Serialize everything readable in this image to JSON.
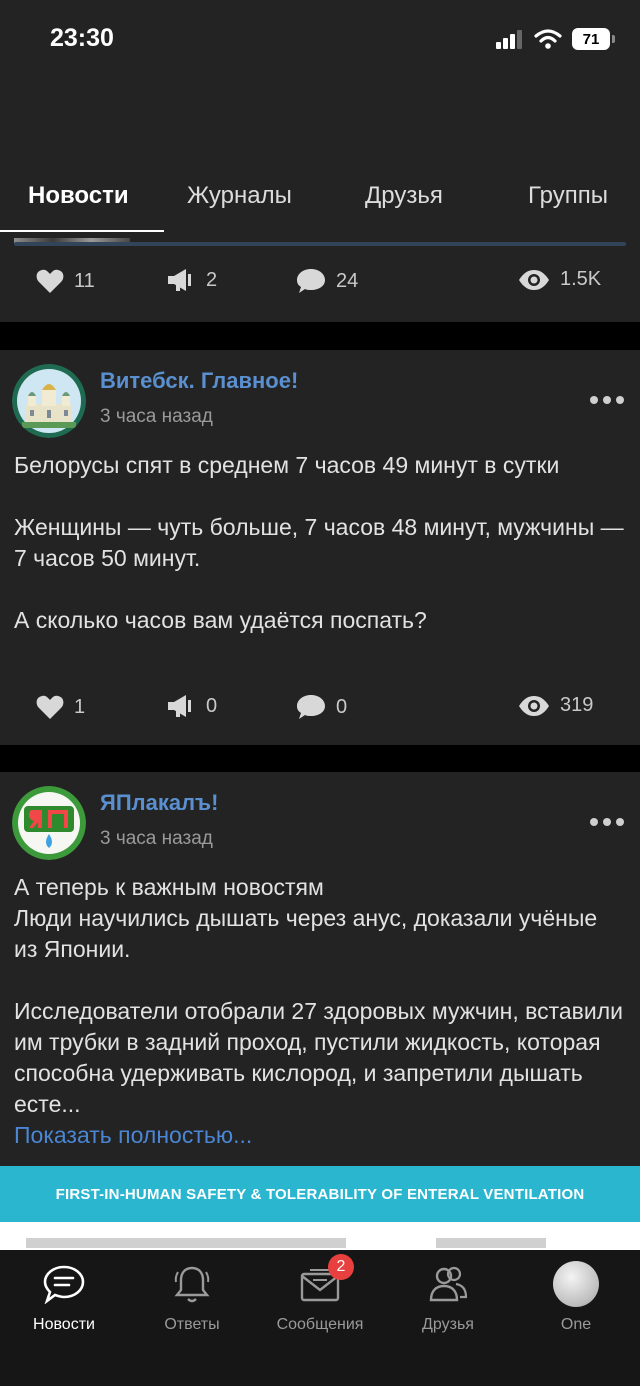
{
  "status_bar": {
    "time": "23:30",
    "battery": "71"
  },
  "tabs": [
    {
      "label": "Новости",
      "active": true
    },
    {
      "label": "Журналы",
      "active": false
    },
    {
      "label": "Друзья",
      "active": false
    },
    {
      "label": "Группы",
      "active": false
    }
  ],
  "post1": {
    "likes": "11",
    "reposts": "2",
    "comments": "24",
    "views": "1.5K"
  },
  "post2": {
    "group": "Витебск. Главное!",
    "time": "3 часа назад",
    "lines": [
      "Белорусы спят в среднем 7 часов 49 минут в сутки",
      "",
      "Женщины — чуть больше, 7 часов 48 минут, мужчины — 7 часов 50 минут.",
      "",
      "А сколько часов вам удаётся поспать?"
    ],
    "likes": "1",
    "reposts": "0",
    "comments": "0",
    "views": "319"
  },
  "post3": {
    "group": "ЯПлакалъ!",
    "time": "3 часа назад",
    "lines": [
      "А теперь к важным новостям",
      "Люди научились дышать через анус, доказали учёные из Японии.",
      "",
      "Исследователи отобрали 27 здоровых мужчин, вставили им трубки в задний проход, пустили жидкость, которая способна удерживать кислород, и запретили дышать есте..."
    ],
    "show_more": "Показать полностью...",
    "banner_title": "FIRST-IN-HUMAN SAFETY & TOLERABILITY OF ENTERAL VENTILATION"
  },
  "bottom_nav": {
    "news": "Новости",
    "answers": "Ответы",
    "messages": "Сообщения",
    "messages_badge": "2",
    "friends": "Друзья",
    "profile": "One"
  },
  "colors": {
    "accent": "#5a8fd0",
    "link": "#4a86d4",
    "badge": "#e8403f",
    "card": "#232323"
  }
}
